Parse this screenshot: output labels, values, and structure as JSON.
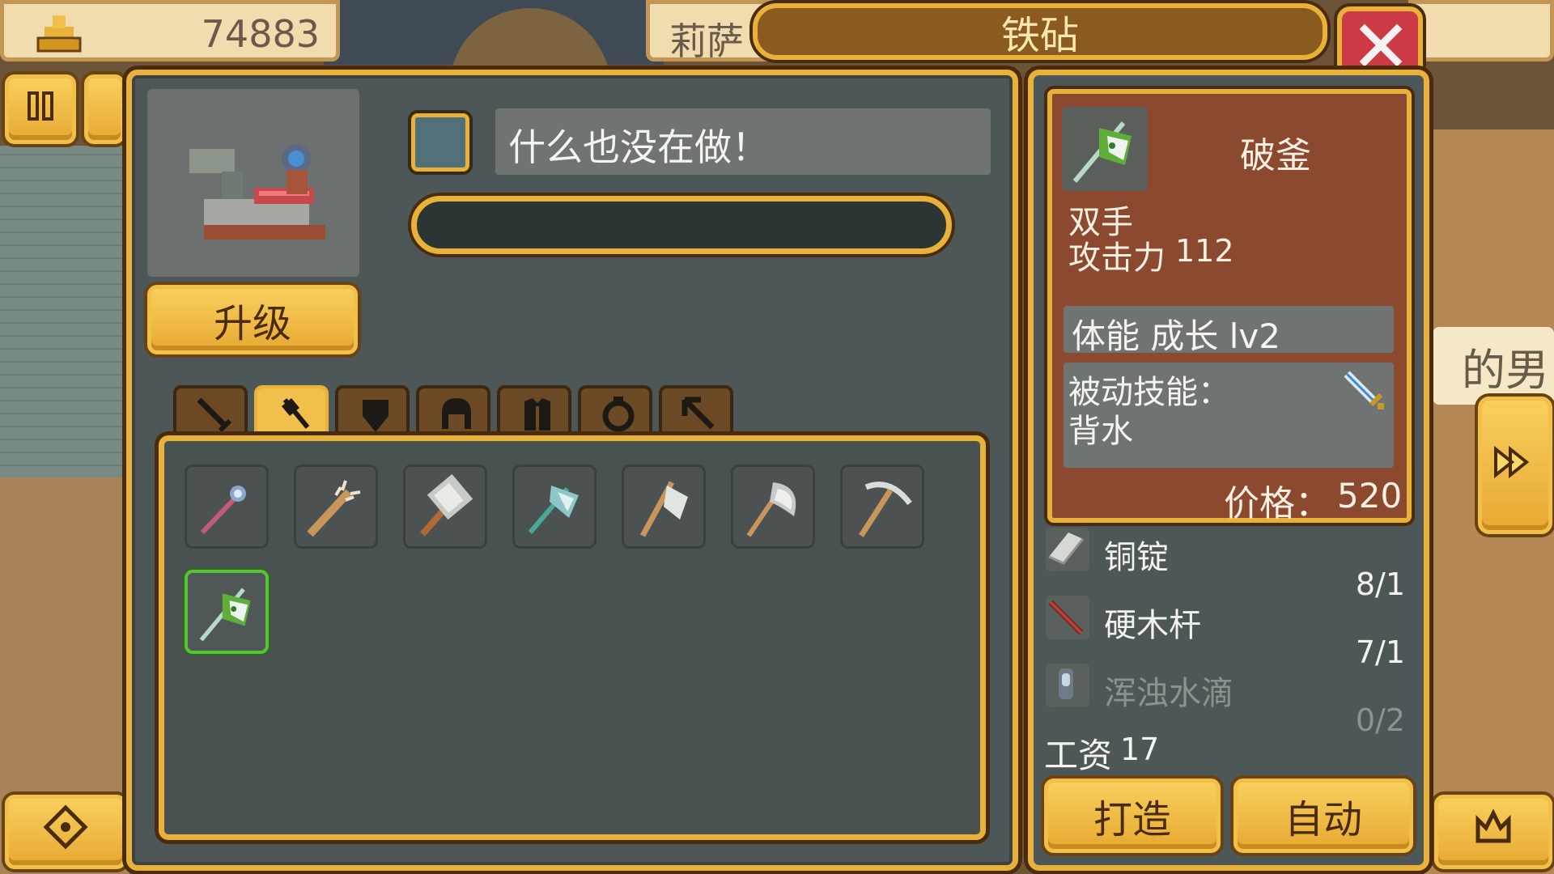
{
  "hud": {
    "gold": "74883",
    "customer_name_partial": "莉萨",
    "building_title": "铁砧",
    "right_bg_text": "的男"
  },
  "workshop": {
    "status_text": "什么也没在做！",
    "upgrade_label": "升级",
    "progress": 0
  },
  "categories": {
    "tabs": [
      {
        "name": "sword",
        "icon": "sword-icon"
      },
      {
        "name": "axe",
        "icon": "axe-icon"
      },
      {
        "name": "shield",
        "icon": "shield-icon"
      },
      {
        "name": "helmet",
        "icon": "helmet-icon"
      },
      {
        "name": "armor",
        "icon": "armor-icon"
      },
      {
        "name": "ring",
        "icon": "ring-icon"
      },
      {
        "name": "tool",
        "icon": "arrow-icon"
      }
    ],
    "active_index": 1
  },
  "items": [
    {
      "icon": "mace-icon"
    },
    {
      "icon": "spiked-club-icon"
    },
    {
      "icon": "warhammer-icon"
    },
    {
      "icon": "crystal-axe-icon"
    },
    {
      "icon": "hatchet-icon"
    },
    {
      "icon": "double-axe-icon"
    },
    {
      "icon": "pickaxe-icon"
    },
    {
      "icon": "broken-cauldron-axe-icon",
      "selected": true
    }
  ],
  "detail": {
    "item_name": "破釜",
    "hand_type": "双手",
    "attack_label": "攻击力",
    "attack_value": "112",
    "stat_line": "体能 成长 lv2",
    "passive_label": "被动技能：",
    "passive_value": "背水",
    "price_label": "价格：",
    "price_value": "520"
  },
  "materials": [
    {
      "name": "铜锭",
      "count": "8/1",
      "available": true,
      "icon": "ingot-icon"
    },
    {
      "name": "硬木杆",
      "count": "7/1",
      "available": true,
      "icon": "wood-stick-icon"
    },
    {
      "name": "浑浊水滴",
      "count": "0/2",
      "available": false,
      "icon": "water-drop-icon"
    }
  ],
  "wage": {
    "label": "工资",
    "value": "17"
  },
  "actions": {
    "craft_label": "打造",
    "auto_label": "自动"
  },
  "colors": {
    "gold": "#e8b13a",
    "panel": "#4e5757",
    "detail_bg": "#8a4a2e",
    "selected": "#58c33a"
  }
}
